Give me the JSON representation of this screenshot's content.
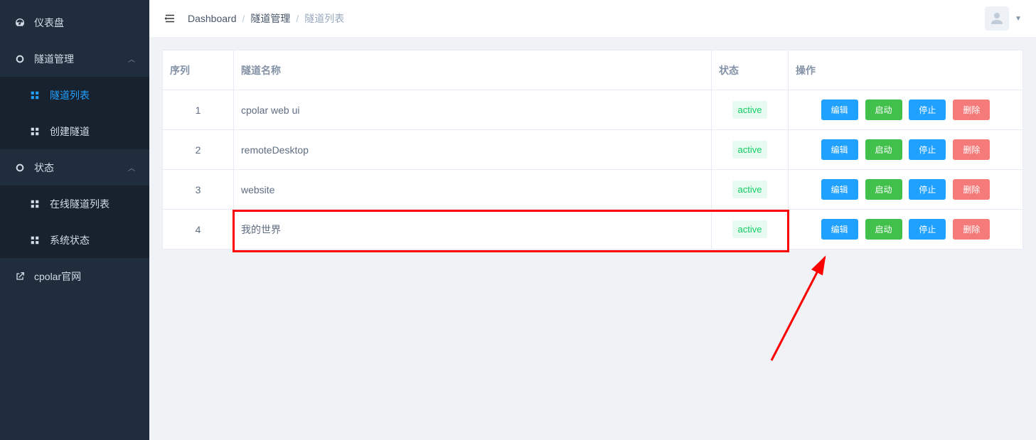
{
  "sidebar": {
    "dashboard": "仪表盘",
    "tunnel_mgmt": "隧道管理",
    "tunnel_list": "隧道列表",
    "tunnel_create": "创建隧道",
    "status": "状态",
    "online_tunnels": "在线隧道列表",
    "system_status": "系统状态",
    "official_site": "cpolar官网"
  },
  "breadcrumb": {
    "dashboard": "Dashboard",
    "tunnel_mgmt": "隧道管理",
    "tunnel_list": "隧道列表"
  },
  "table": {
    "headers": {
      "index": "序列",
      "name": "隧道名称",
      "status": "状态",
      "ops": "操作"
    },
    "actions": {
      "edit": "编辑",
      "start": "启动",
      "stop": "停止",
      "delete": "删除"
    },
    "rows": [
      {
        "idx": "1",
        "name": "cpolar web ui",
        "status": "active"
      },
      {
        "idx": "2",
        "name": "remoteDesktop",
        "status": "active"
      },
      {
        "idx": "3",
        "name": "website",
        "status": "active"
      },
      {
        "idx": "4",
        "name": "我的世界",
        "status": "active"
      }
    ]
  }
}
